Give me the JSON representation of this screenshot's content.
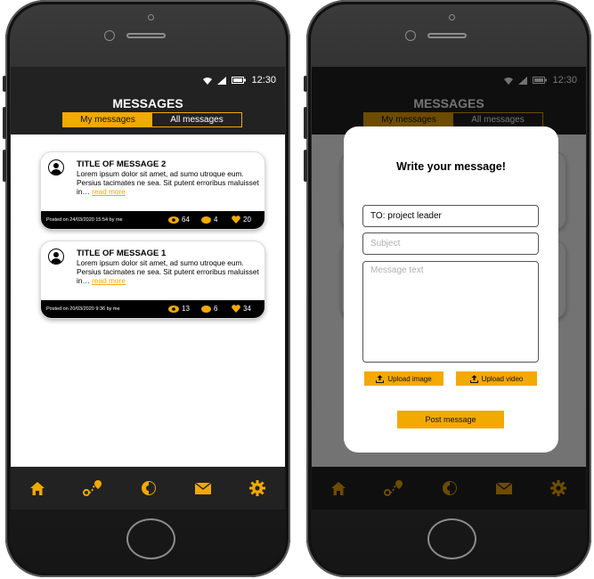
{
  "status": {
    "time": "12:30"
  },
  "header": {
    "title": "MESSAGES",
    "tabs": [
      {
        "label": "My messages",
        "active": true
      },
      {
        "label": "All messages",
        "active": false
      }
    ]
  },
  "messages": [
    {
      "title": "TITLE OF MESSAGE  2",
      "body": "Lorem ipsum dolor sit amet, ad sumo utroque eum. Persius tacimates ne sea. Sit putent erroribus maluisset in…",
      "read_more": "read more",
      "posted": "Posted on 24/03/2020 15:54 by me",
      "views": "64",
      "comments": "4",
      "likes": "20"
    },
    {
      "title": "TITLE OF MESSAGE  1",
      "body": "Lorem ipsum dolor sit amet, ad sumo utroque eum. Persius tacimates ne sea. Sit putent erroribus maluisset in…",
      "read_more": "read more",
      "posted": "Posted on 20/03/2020 9:36 by me",
      "views": "13",
      "comments": "6",
      "likes": "34"
    }
  ],
  "nav": {
    "icons": [
      "home-icon",
      "route-icon",
      "contrast-icon",
      "mail-icon",
      "settings-icon"
    ]
  },
  "modal": {
    "heading": "Write your message!",
    "to_value": "TO: project leader",
    "subject_placeholder": "Subject",
    "message_placeholder": "Message text",
    "upload_image": "Upload image",
    "upload_video": "Upload video",
    "post": "Post message"
  },
  "colors": {
    "accent": "#f2a900",
    "dark": "#222222"
  }
}
